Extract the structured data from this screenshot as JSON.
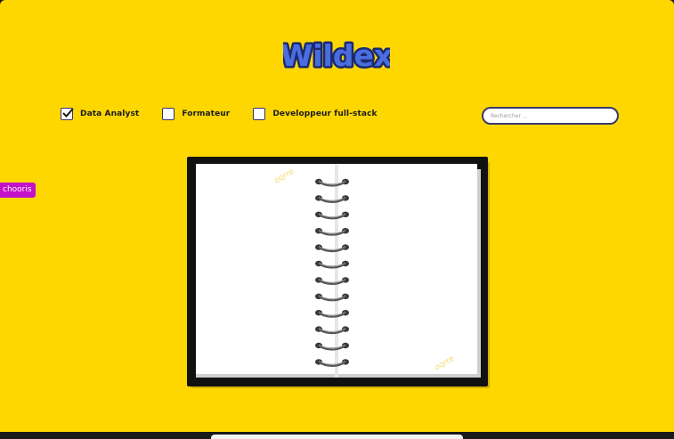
{
  "header": {
    "logo_text": "Wildex"
  },
  "filters": [
    {
      "label": "Data Analyst",
      "checked": true
    },
    {
      "label": "Formateur",
      "checked": false
    },
    {
      "label": "Developpeur full-stack",
      "checked": false
    }
  ],
  "search": {
    "placeholder": "Rechercher ..."
  },
  "side_tag": {
    "label": "chooris"
  },
  "colors": {
    "background": "#ffd700",
    "checkbox_border": "#33336b",
    "side_tag": "#c311c9"
  },
  "icons": [
    "check-icon",
    "notebook-image"
  ]
}
